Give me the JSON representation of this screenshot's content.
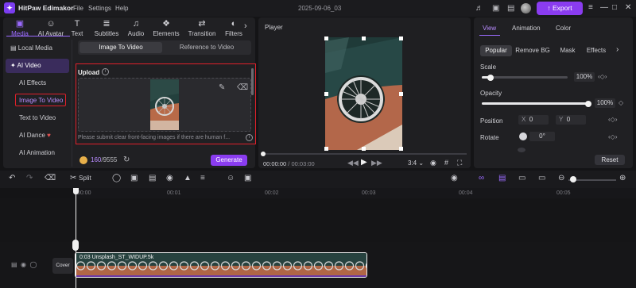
{
  "titlebar": {
    "logo": "✦",
    "app_name": "HitPaw Edimakor",
    "menu": [
      "File",
      "Settings",
      "Help"
    ],
    "project_name": "2025-09-06_03",
    "export_label": "Export",
    "icons": [
      "bell-icon",
      "chat-icon",
      "gift-icon",
      "info-icon"
    ]
  },
  "media_tabs": [
    {
      "label": "Media",
      "icon": "▣"
    },
    {
      "label": "AI Avatar",
      "icon": "☺"
    },
    {
      "label": "Text",
      "icon": "T"
    },
    {
      "label": "Subtitles",
      "icon": "≣"
    },
    {
      "label": "Audio",
      "icon": "♫"
    },
    {
      "label": "Elements",
      "icon": "❖"
    },
    {
      "label": "Transition",
      "icon": "⇄"
    },
    {
      "label": "Filters",
      "icon": "◐"
    }
  ],
  "sidebar": {
    "items": [
      {
        "label": "Local Media",
        "icon": "▤"
      },
      {
        "label": "AI Video",
        "icon": "✦"
      }
    ],
    "sub_items": [
      "AI Effects",
      "Image To Video",
      "Text to Video",
      "AI Dance",
      "AI Animation"
    ]
  },
  "i2v": {
    "tabs": [
      "Image To Video",
      "Reference to Video"
    ],
    "upload_label": "Upload",
    "hint": "Please submit clear front-facing images if there are human f...",
    "credits": "160",
    "credits_total": "/9555",
    "generate_label": "Generate"
  },
  "player": {
    "title": "Player",
    "time_current": "00:00:00",
    "time_separator": "/",
    "time_total": "00:03:00",
    "aspect": "3:4",
    "progress": 0
  },
  "properties": {
    "tabs": [
      "View",
      "Animation",
      "Color"
    ],
    "subtabs": [
      "Popular",
      "Remove BG",
      "Mask",
      "Effects"
    ],
    "scale_label": "Scale",
    "scale_value": "100%",
    "scale_level": 0.1,
    "opacity_label": "Opacity",
    "opacity_value": "100%",
    "opacity_level": 1.0,
    "position_label": "Position",
    "pos_x_label": "X",
    "pos_x": "0",
    "pos_y_label": "Y",
    "pos_y": "0",
    "rotate_label": "Rotate",
    "rotate_value": "0°",
    "reset_label": "Reset"
  },
  "toolbar": {
    "split_label": "Split"
  },
  "ruler": {
    "ticks": [
      "00:00",
      "00:01",
      "00:02",
      "00:03",
      "00:04",
      "00:05"
    ]
  },
  "track": {
    "cover_label": "Cover",
    "clip_label": "0:03  Unsplash_ST_WIDUP.5k"
  },
  "colors": {
    "accent": "#8a3cf0",
    "highlight_box": "#e0202a",
    "panel": "#202023"
  }
}
